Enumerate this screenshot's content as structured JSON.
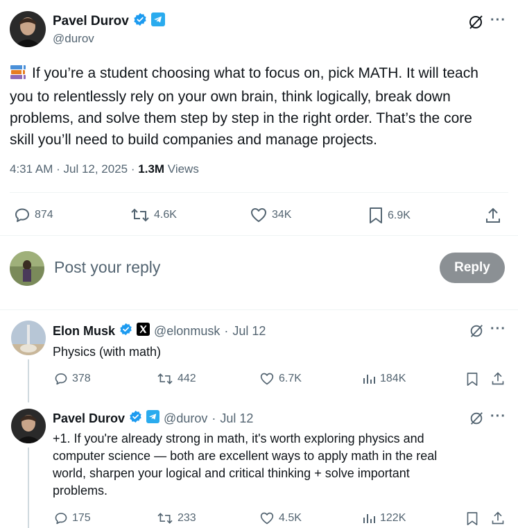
{
  "main_tweet": {
    "author_name": "Pavel Durov",
    "handle": "@durov",
    "text": "If you’re a student choosing what to focus on, pick MATH. It will teach you to relentlessly rely on your own brain, think logically, break down problems, and solve them step by step in the right order. That’s the core skill you’ll need to build companies and manage projects.",
    "line1": "If you’re a student choosing what to focus on, pick MATH. It will teach",
    "line2": "you to relentlessly rely on your own brain, think logically, break down",
    "line3": "problems, and solve them step by step in the right order. That’s the core",
    "line4": "skill you’ll need to build companies and manage projects.",
    "time": "4:31 AM",
    "date": "Jul 12, 2025",
    "views_count": "1.3M",
    "views_label": "Views",
    "replies": "874",
    "reposts": "4.6K",
    "likes": "34K",
    "bookmarks": "6.9K"
  },
  "composer": {
    "placeholder": "Post your reply",
    "button_label": "Reply"
  },
  "replies": [
    {
      "author_name": "Elon Musk",
      "handle": "@elonmusk",
      "date": "Jul 12",
      "text": "Physics (with math)",
      "replies": "378",
      "reposts": "442",
      "likes": "6.7K",
      "views": "184K"
    },
    {
      "author_name": "Pavel Durov",
      "handle": "@durov",
      "date": "Jul 12",
      "text": "+1. If you're already strong in math, it's worth exploring physics and computer science — both are excellent ways to apply math in the real world, sharpen your logical and critical thinking + solve important problems.",
      "line1": "+1. If you're already strong in math, it's worth exploring physics and",
      "line2": "computer science — both are excellent ways to apply math in the real",
      "line3": "world, sharpen your logical and critical thinking + solve important",
      "line4": "problems.",
      "replies": "175",
      "reposts": "233",
      "likes": "4.5K",
      "views": "122K"
    }
  ],
  "colors": {
    "verified_blue": "#1d9bf0",
    "telegram_blue": "#2aabee",
    "muted_text": "#536471",
    "reply_button": "#8b9094"
  }
}
